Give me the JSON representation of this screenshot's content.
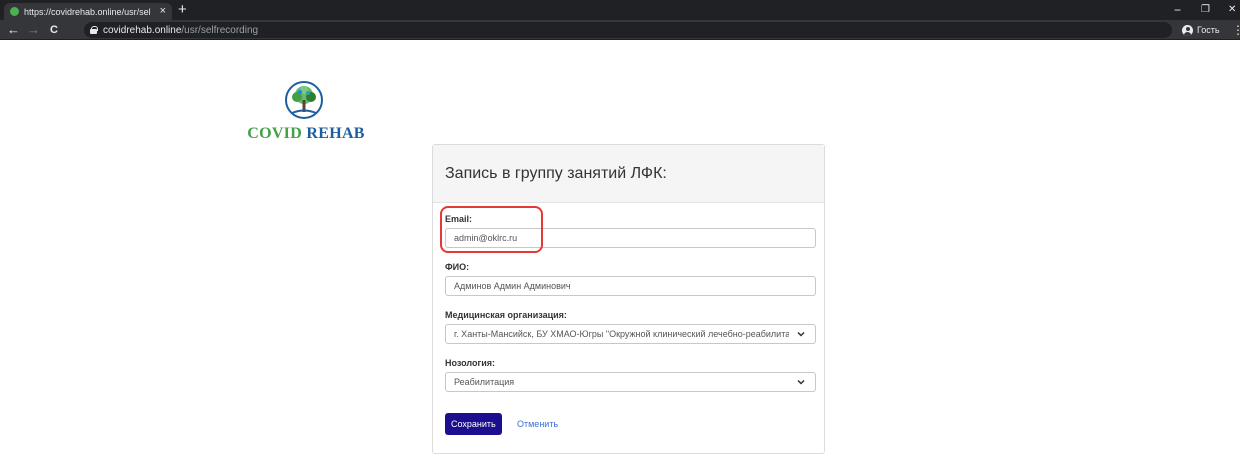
{
  "browser": {
    "tab_title": "https://covidrehab.online/usr/sel",
    "tab_close_glyph": "×",
    "new_tab_glyph": "+",
    "window": {
      "minimize": "−",
      "restore": "❐",
      "close": "✕"
    },
    "nav": {
      "back": "←",
      "forward": "→",
      "reload": "C"
    },
    "url_host": "covidrehab.online",
    "url_path": "/usr/selfrecording",
    "profile_label": "Гость",
    "menu_glyph": "⋮"
  },
  "logo": {
    "word1": "COVID",
    "word2": "REHAB"
  },
  "form": {
    "title": "Запись в группу занятий ЛФК:",
    "email": {
      "label": "Email:",
      "value": "admin@oklrc.ru"
    },
    "fio": {
      "label": "ФИО:",
      "value": "Админов Админ Админович"
    },
    "org": {
      "label": "Медицинская организация:",
      "value": "г. Ханты-Мансийск, БУ ХМАО-Югры \"Окружной клинический лечебно-реабилитационный центр\""
    },
    "nosology": {
      "label": "Нозология:",
      "value": "Реабилитация"
    },
    "save_label": "Сохранить",
    "cancel_label": "Отменить"
  },
  "colors": {
    "accent_button": "#1c0f8f",
    "link": "#3b6fd6",
    "highlight": "#e53935",
    "logo_green": "#43a047",
    "logo_blue": "#1e5e9e"
  }
}
